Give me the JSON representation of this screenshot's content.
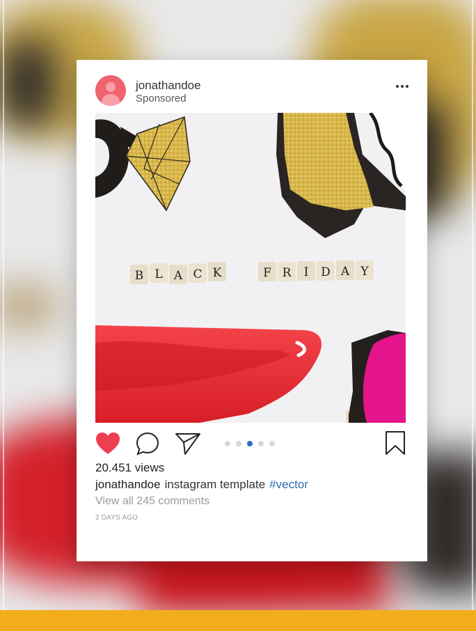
{
  "post": {
    "username": "jonathandoe",
    "sponsored_label": "Sponsored",
    "views": "20.451 views",
    "caption_user": "jonathandoe",
    "caption_text": "instagram template",
    "hashtag": "#vector",
    "view_comments": "View all 245 comments",
    "date": "2 DAYS AGO"
  },
  "photo": {
    "letters_1": [
      "B",
      "L",
      "A",
      "C",
      "K"
    ],
    "letters_2": [
      "F",
      "R",
      "I",
      "D",
      "A",
      "Y"
    ]
  },
  "carousel": {
    "total": 5,
    "active_index": 2
  },
  "icons": {
    "avatar": "user-avatar-icon",
    "more": "more-options-icon",
    "like": "heart-icon",
    "comment": "comment-icon",
    "share": "send-icon",
    "save": "bookmark-icon"
  },
  "colors": {
    "like": "#ef3e52",
    "hashtag": "#2e6fb6",
    "active_dot": "#2d6fba",
    "bottom_bar": "#f2ad1d"
  }
}
